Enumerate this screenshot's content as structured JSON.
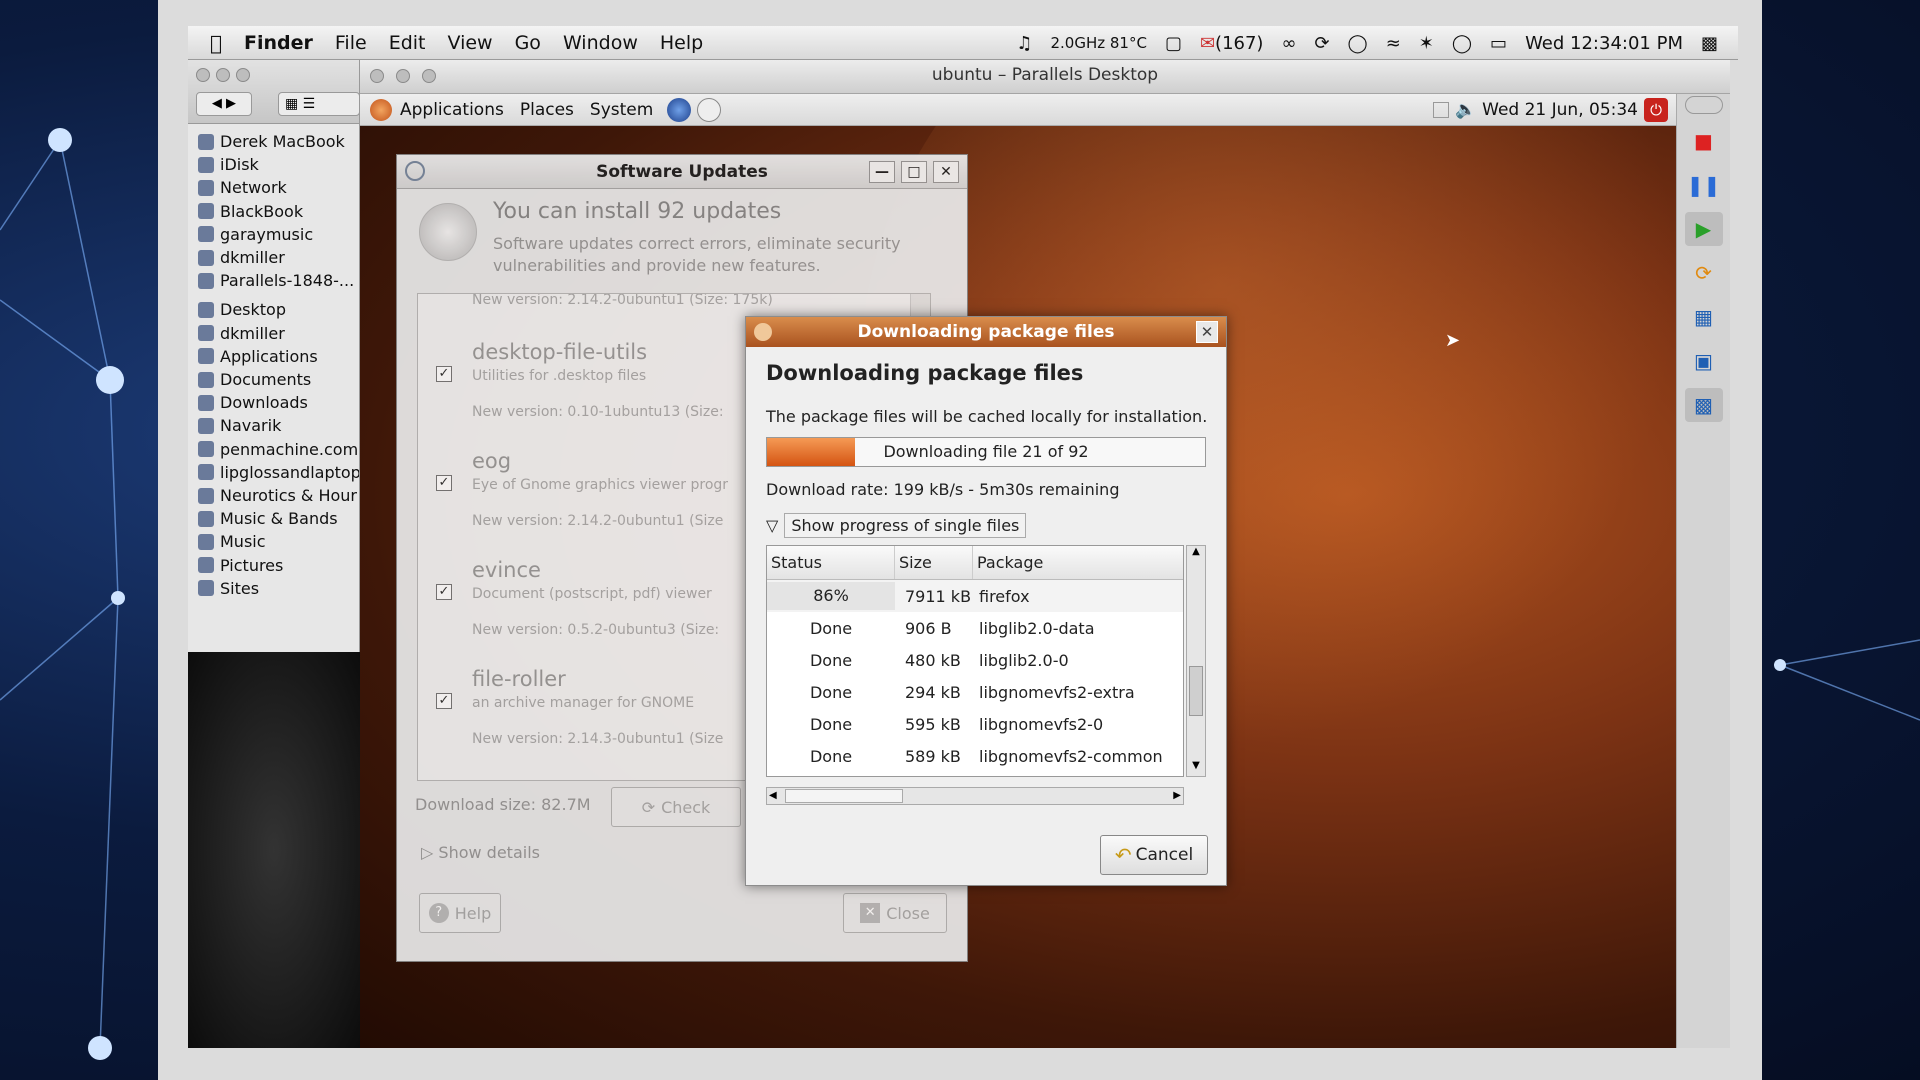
{
  "mac_menubar": {
    "apple": "",
    "items": [
      "Finder",
      "File",
      "Edit",
      "View",
      "Go",
      "Window",
      "Help"
    ],
    "cpu": "2.0GHz 81°C",
    "mail_count": "(167)",
    "clock": "Wed 12:34:01 PM"
  },
  "finder": {
    "devices": [
      "Derek MacBook",
      "iDisk",
      "Network",
      "BlackBook",
      "garaymusic",
      "dkmiller",
      "Parallels-1848-..."
    ],
    "places": [
      "Desktop",
      "dkmiller",
      "Applications",
      "Documents",
      "Downloads",
      "Navarik",
      "penmachine.com",
      "lipglossandlaptop",
      "Neurotics & Hour",
      "Music & Bands",
      "Music",
      "Pictures",
      "Sites"
    ]
  },
  "parallels": {
    "title": "ubuntu – Parallels Desktop"
  },
  "gnome_panel": {
    "applications": "Applications",
    "places": "Places",
    "system": "System",
    "clock": "Wed 21 Jun, 05:34"
  },
  "software_updates": {
    "title": "Software Updates",
    "headline": "You can install 92 updates",
    "description": "Software updates correct errors, eliminate security vulnerabilities and provide new features.",
    "top_version": "New version: 2.14.2-0ubuntu1   (Size: 175k)",
    "updates": [
      {
        "name": "desktop-file-utils",
        "desc": "Utilities for .desktop files",
        "version": "New version: 0.10-1ubuntu13    (Size:"
      },
      {
        "name": "eog",
        "desc": "Eye of Gnome graphics viewer progr",
        "version": "New version: 2.14.2-0ubuntu1    (Size"
      },
      {
        "name": "evince",
        "desc": "Document (postscript, pdf) viewer",
        "version": "New version: 0.5.2-0ubuntu3    (Size:"
      },
      {
        "name": "file-roller",
        "desc": "an archive manager for GNOME",
        "version": "New version: 2.14.3-0ubuntu1    (Size"
      }
    ],
    "download_size": "Download size: 82.7M",
    "check": "Check",
    "show_details": "Show details",
    "help": "Help",
    "close": "Close"
  },
  "download_dialog": {
    "title": "Downloading package files",
    "heading": "Downloading package files",
    "message": "The package files will be cached locally for installation.",
    "progress_text": "Downloading file 21 of 92",
    "progress_fraction": 0.2,
    "rate": "Download rate: 199 kB/s - 5m30s remaining",
    "expander": "Show progress of single files",
    "columns": [
      "Status",
      "Size",
      "Package"
    ],
    "rows": [
      {
        "status": "86%",
        "size": "7911 kB",
        "package": "firefox"
      },
      {
        "status": "Done",
        "size": "906  B",
        "package": "libglib2.0-data"
      },
      {
        "status": "Done",
        "size": "480 kB",
        "package": "libglib2.0-0"
      },
      {
        "status": "Done",
        "size": "294 kB",
        "package": "libgnomevfs2-extra"
      },
      {
        "status": "Done",
        "size": "595 kB",
        "package": "libgnomevfs2-0"
      },
      {
        "status": "Done",
        "size": "589 kB",
        "package": "libgnomevfs2-common"
      }
    ],
    "cancel": "Cancel"
  }
}
